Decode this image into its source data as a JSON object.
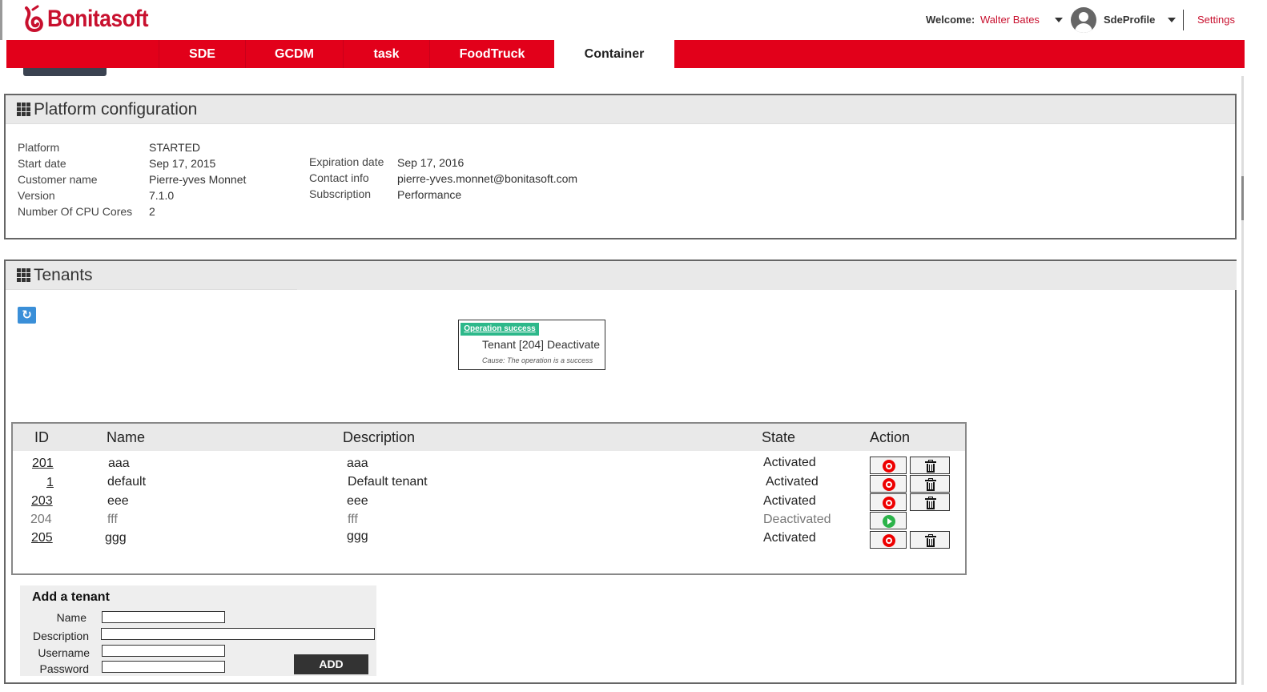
{
  "header": {
    "brand": "Bonitasoft",
    "welcome_label": "Welcome:",
    "user_name": "Walter Bates",
    "profile_name": "SdeProfile",
    "settings_label": "Settings"
  },
  "nav": {
    "tabs": [
      {
        "label": "SDE"
      },
      {
        "label": "GCDM"
      },
      {
        "label": "task"
      },
      {
        "label": "FoodTruck"
      },
      {
        "label": "Container"
      }
    ],
    "active_tab": "Container"
  },
  "platform": {
    "title": "Platform configuration",
    "left": [
      {
        "label": "Platform",
        "value": "STARTED"
      },
      {
        "label": "Start date",
        "value": "Sep 17, 2015"
      },
      {
        "label": "Customer name",
        "value": "Pierre-yves Monnet"
      },
      {
        "label": "Version",
        "value": "7.1.0"
      },
      {
        "label": "Number Of CPU Cores",
        "value": "2"
      }
    ],
    "right": [
      {
        "label": "Expiration date",
        "value": "Sep 17, 2016"
      },
      {
        "label": "Contact info",
        "value": "pierre-yves.monnet@bonitasoft.com"
      },
      {
        "label": "Subscription",
        "value": "Performance"
      }
    ]
  },
  "tenants": {
    "title": "Tenants",
    "refresh_icon": "refresh-icon",
    "toast": {
      "tag": "Operation success",
      "message": "Tenant [204] Deactivate",
      "cause": "Cause: The operation is a success",
      "tag_color": "#2db88a"
    },
    "columns": [
      "ID",
      "Name",
      "Description",
      "State",
      "Action"
    ],
    "rows": [
      {
        "id": "201",
        "name": "aaa",
        "description": "aaa",
        "state": "Activated",
        "active": true,
        "deletable": true
      },
      {
        "id": "1",
        "name": "default",
        "description": "Default tenant",
        "state": "Activated",
        "active": true,
        "deletable": true
      },
      {
        "id": "203",
        "name": "eee",
        "description": "eee",
        "state": "Activated",
        "active": true,
        "deletable": true
      },
      {
        "id": "204",
        "name": "fff",
        "description": "fff",
        "state": "Deactivated",
        "active": false,
        "deletable": false
      },
      {
        "id": "205",
        "name": "ggg",
        "description": "ggg",
        "state": "Activated",
        "active": true,
        "deletable": true
      }
    ]
  },
  "add_tenant": {
    "title": "Add a tenant",
    "fields": [
      {
        "label": "Name",
        "value": ""
      },
      {
        "label": "Description",
        "value": ""
      },
      {
        "label": "Username",
        "value": ""
      },
      {
        "label": "Password",
        "value": ""
      }
    ],
    "add_label": "ADD"
  },
  "colors": {
    "brand_red": "#e2001a",
    "accent_blue": "#3a8fd8"
  }
}
